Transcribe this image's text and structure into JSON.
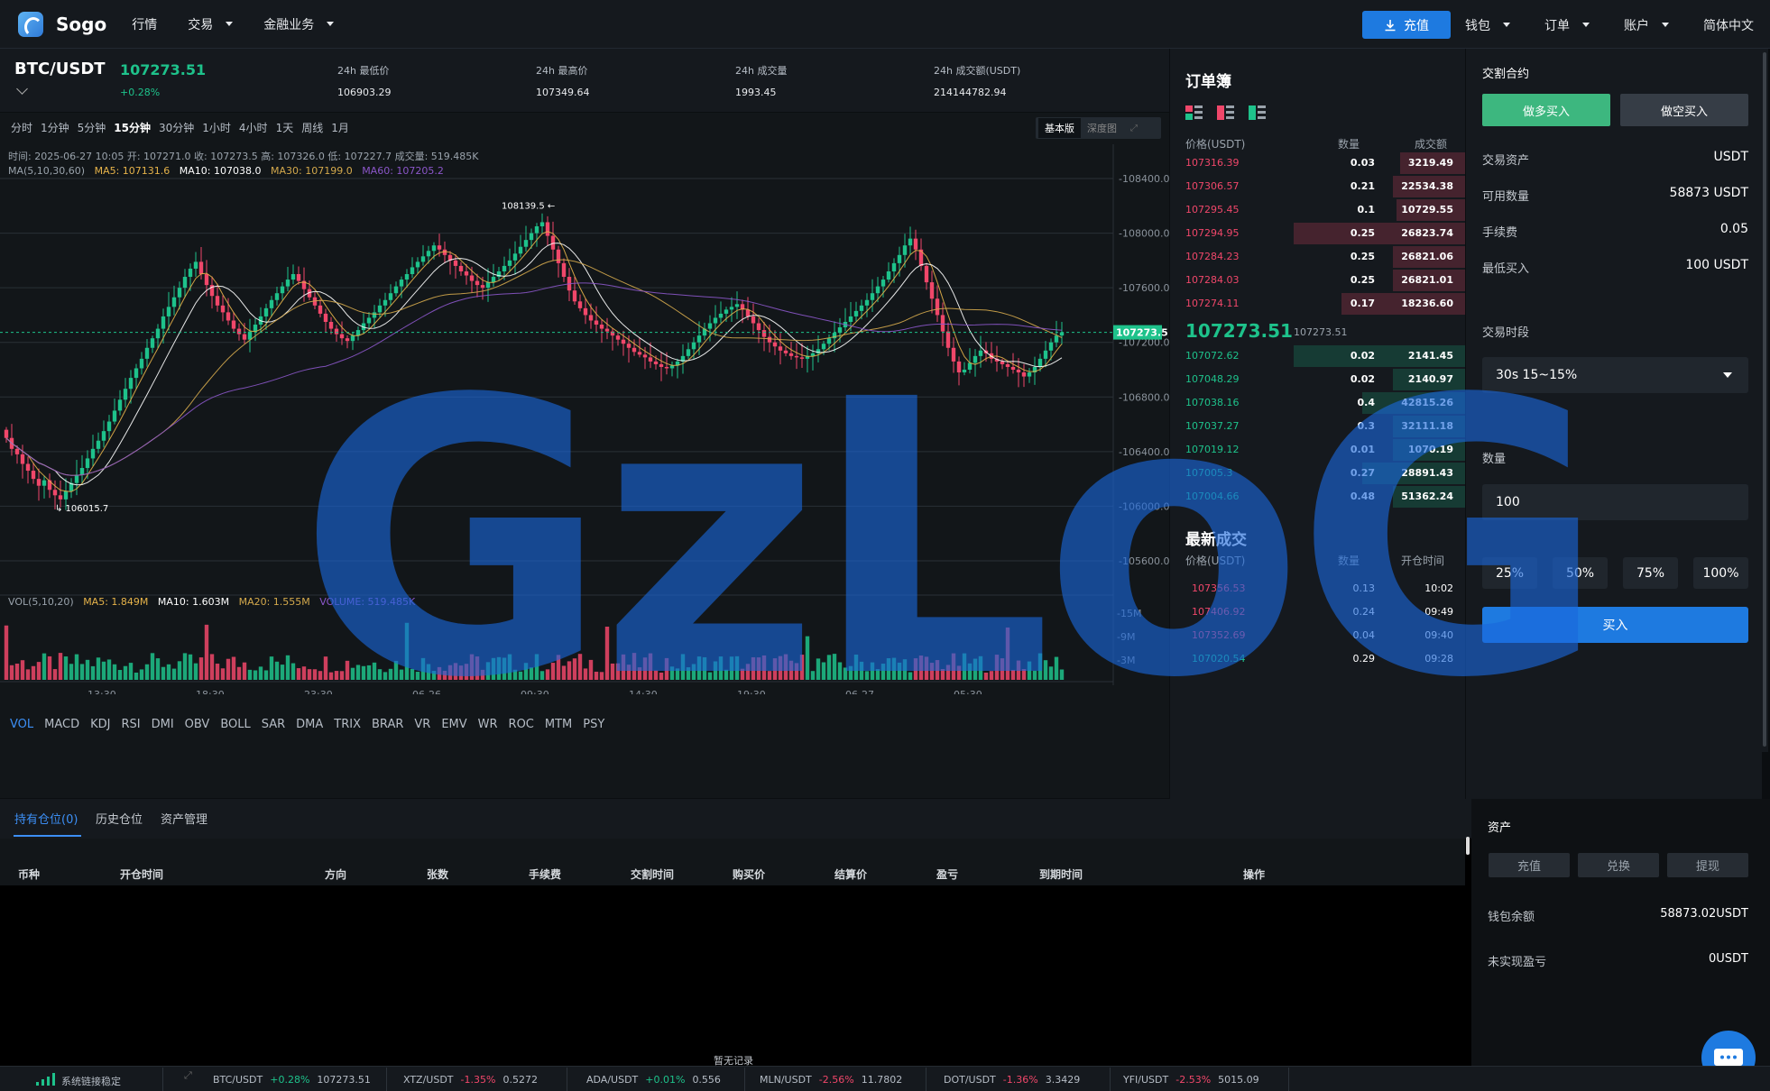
{
  "nav": {
    "logo": "Sogo",
    "items": [
      "行情",
      "交易",
      "金融业务"
    ],
    "recharge": "充值",
    "right_items": [
      "钱包",
      "订单",
      "账户"
    ],
    "language": "简体中文"
  },
  "ticker": {
    "pair": "BTC/USDT",
    "last": "107273.51",
    "change": "+0.28%",
    "stats": [
      {
        "label": "24h 最低价",
        "value": "106903.29"
      },
      {
        "label": "24h 最高价",
        "value": "107349.64"
      },
      {
        "label": "24h 成交量",
        "value": "1993.45"
      },
      {
        "label": "24h 成交额(USDT)",
        "value": "214144782.94"
      }
    ]
  },
  "timeframes": [
    "分时",
    "1分钟",
    "5分钟",
    "15分钟",
    "30分钟",
    "1小时",
    "4小时",
    "1天",
    "周线",
    "1月"
  ],
  "timeframe_active": "15分钟",
  "chart_mode": {
    "basic": "基本版",
    "depth": "深度图"
  },
  "ohlc_line": "时间: 2025-06-27 10:05    开: 107271.0    收: 107273.5    高: 107326.0    低: 107227.7    成交量: 519.485K",
  "ma_line": {
    "label": "MA(5,10,30,60)",
    "ma5": "MA5: 107131.6",
    "ma10": "MA10: 107038.0",
    "ma30": "MA30: 107199.0",
    "ma60": "MA60: 107205.2"
  },
  "vol_line": {
    "label": "VOL(5,10,20)",
    "ma5": "MA5: 1.849M",
    "ma10": "MA10: 1.603M",
    "ma20": "MA20: 1.555M",
    "volume": "VOLUME: 519.485K"
  },
  "indicators": [
    "VOL",
    "MACD",
    "KDJ",
    "RSI",
    "DMI",
    "OBV",
    "BOLL",
    "SAR",
    "DMA",
    "TRIX",
    "BRAR",
    "VR",
    "EMV",
    "WR",
    "ROC",
    "MTM",
    "PSY"
  ],
  "indicator_active": "VOL",
  "colors": {
    "up": "#1ec28b",
    "down": "#f0476a",
    "accent": "#1e7ae0",
    "ma5": "#e6b34a",
    "ma10": "#ffffff",
    "ma30": "#d4a94c",
    "ma60": "#8b56c9"
  },
  "chart_data": {
    "type": "candlestick",
    "y_ticks": [
      "108400.0",
      "108000.0",
      "107600.0",
      "107200.0",
      "106800.0",
      "106400.0",
      "106000.0",
      "105600.0"
    ],
    "ylim": [
      105600,
      108400
    ],
    "x_ticks": [
      "13:30",
      "18:30",
      "23:30",
      "06-26",
      "09:30",
      "14:30",
      "19:30",
      "06-27",
      "05:30"
    ],
    "vol_ticks": [
      "15M",
      "9M",
      "3M"
    ],
    "current_price_label": "107273.5",
    "high_label": "108139.5",
    "low_label": "106015.7",
    "closes": [
      106500,
      106420,
      106380,
      106310,
      106260,
      106200,
      106150,
      106190,
      106120,
      106080,
      106050,
      106110,
      106170,
      106230,
      106280,
      106350,
      106420,
      106480,
      106550,
      106620,
      106700,
      106780,
      106860,
      106940,
      107010,
      107080,
      107160,
      107230,
      107300,
      107390,
      107460,
      107530,
      107600,
      107680,
      107740,
      107790,
      107700,
      107620,
      107540,
      107470,
      107420,
      107360,
      107300,
      107260,
      107220,
      107280,
      107330,
      107390,
      107450,
      107510,
      107560,
      107610,
      107660,
      107700,
      107650,
      107590,
      107530,
      107470,
      107410,
      107350,
      107300,
      107260,
      107230,
      107210,
      107250,
      107290,
      107340,
      107380,
      107420,
      107470,
      107510,
      107560,
      107610,
      107660,
      107700,
      107750,
      107790,
      107830,
      107870,
      107910,
      107880,
      107840,
      107800,
      107760,
      107720,
      107690,
      107650,
      107620,
      107600,
      107640,
      107680,
      107720,
      107760,
      107800,
      107850,
      107900,
      107950,
      108000,
      108050,
      108080,
      107980,
      107880,
      107780,
      107680,
      107580,
      107500,
      107450,
      107400,
      107360,
      107330,
      107300,
      107280,
      107250,
      107220,
      107190,
      107160,
      107130,
      107110,
      107090,
      107060,
      107040,
      107020,
      107010,
      107030,
      107060,
      107100,
      107150,
      107200,
      107250,
      107300,
      107340,
      107380,
      107410,
      107440,
      107460,
      107480,
      107440,
      107390,
      107340,
      107290,
      107240,
      107200,
      107170,
      107140,
      107120,
      107100,
      107090,
      107080,
      107100,
      107120,
      107150,
      107190,
      107230,
      107270,
      107310,
      107350,
      107390,
      107430,
      107470,
      107510,
      107560,
      107610,
      107660,
      107720,
      107780,
      107840,
      107910,
      107960,
      107880,
      107760,
      107640,
      107520,
      107400,
      107280,
      107160,
      107060,
      106980,
      107000,
      107050,
      107100,
      107140,
      107120,
      107080,
      107060,
      107040,
      107020,
      107000,
      106980,
      106950,
      106980,
      107020,
      107080,
      107140,
      107200,
      107250,
      107273.5
    ]
  },
  "orderbook": {
    "title": "订单簿",
    "headers": [
      "价格(USDT)",
      "数量",
      "成交额"
    ],
    "asks": [
      {
        "price": "107316.39",
        "qty": "0.03",
        "total": "3219.49",
        "depth": 0.38
      },
      {
        "price": "107306.57",
        "qty": "0.21",
        "total": "22534.38",
        "depth": 0.42
      },
      {
        "price": "107295.45",
        "qty": "0.1",
        "total": "10729.55",
        "depth": 0.4
      },
      {
        "price": "107294.95",
        "qty": "0.25",
        "total": "26823.74",
        "depth": 1.0
      },
      {
        "price": "107284.23",
        "qty": "0.25",
        "total": "26821.06",
        "depth": 0.42
      },
      {
        "price": "107284.03",
        "qty": "0.25",
        "total": "26821.01",
        "depth": 0.42
      },
      {
        "price": "107274.11",
        "qty": "0.17",
        "total": "18236.60",
        "depth": 0.72
      }
    ],
    "mid_price": "107273.51",
    "mid_price_sub": "107273.51",
    "bids": [
      {
        "price": "107072.62",
        "qty": "0.02",
        "total": "2141.45",
        "depth": 1.0
      },
      {
        "price": "107048.29",
        "qty": "0.02",
        "total": "2140.97",
        "depth": 0.42
      },
      {
        "price": "107038.16",
        "qty": "0.4",
        "total": "42815.26",
        "depth": 0.6
      },
      {
        "price": "107037.27",
        "qty": "0.3",
        "total": "32111.18",
        "depth": 0.42
      },
      {
        "price": "107019.12",
        "qty": "0.01",
        "total": "1070.19",
        "depth": 0.42
      },
      {
        "price": "107005.3",
        "qty": "0.27",
        "total": "28891.43",
        "depth": 0.6
      },
      {
        "price": "107004.66",
        "qty": "0.48",
        "total": "51362.24",
        "depth": 0.42
      }
    ]
  },
  "trades": {
    "title": "最新成交",
    "headers": [
      "价格(USDT)",
      "数量",
      "开仓时间"
    ],
    "rows": [
      {
        "price": "107356.53",
        "qty": "0.13",
        "time": "10:02",
        "side": "down"
      },
      {
        "price": "107406.92",
        "qty": "0.24",
        "time": "09:49",
        "side": "down"
      },
      {
        "price": "107352.69",
        "qty": "0.04",
        "time": "09:40",
        "side": "down"
      },
      {
        "price": "107020.54",
        "qty": "0.29",
        "time": "09:28",
        "side": "up"
      }
    ]
  },
  "trade_panel": {
    "title": "交割合约",
    "buy": "做多买入",
    "sell": "做空买入",
    "fields": [
      {
        "label": "交易资产",
        "value": "USDT"
      },
      {
        "label": "可用数量",
        "value": "58873 USDT"
      },
      {
        "label": "手续费",
        "value": "0.05"
      },
      {
        "label": "最低买入",
        "value": "100 USDT"
      }
    ],
    "period_label": "交易时段",
    "period_value": "30s 15~15%",
    "qty_label": "数量",
    "qty_value": "100",
    "percents": [
      "25%",
      "50%",
      "75%",
      "100%"
    ],
    "submit": "买入"
  },
  "bottom": {
    "tabs": [
      "持有仓位(0)",
      "历史仓位",
      "资产管理"
    ],
    "columns": [
      "币种",
      "开仓时间",
      "方向",
      "张数",
      "手续费",
      "交割时间",
      "购买价",
      "结算价",
      "盈亏",
      "到期时间",
      "操作"
    ],
    "empty": "暂无记录"
  },
  "assets": {
    "title": "资产",
    "buttons": [
      "充值",
      "兑换",
      "提现"
    ],
    "wallet_label": "钱包余额",
    "wallet_value": "58873.02USDT",
    "pnl_label": "未实现盈亏",
    "pnl_value": "0USDT"
  },
  "status_bar": {
    "connection": "系统链接稳定",
    "tickers": [
      {
        "pair": "BTC/USDT",
        "change": "+0.28%",
        "price": "107273.51",
        "dir": "up"
      },
      {
        "pair": "XTZ/USDT",
        "change": "-1.35%",
        "price": "0.5272",
        "dir": "down"
      },
      {
        "pair": "ADA/USDT",
        "change": "+0.01%",
        "price": "0.556",
        "dir": "up"
      },
      {
        "pair": "MLN/USDT",
        "change": "-2.56%",
        "price": "11.7802",
        "dir": "down"
      },
      {
        "pair": "DOT/USDT",
        "change": "-1.36%",
        "price": "3.3429",
        "dir": "down"
      },
      {
        "pair": "YFI/USDT",
        "change": "-2.53%",
        "price": "5015.09",
        "dir": "down"
      }
    ]
  },
  "watermark": "GzLoG"
}
